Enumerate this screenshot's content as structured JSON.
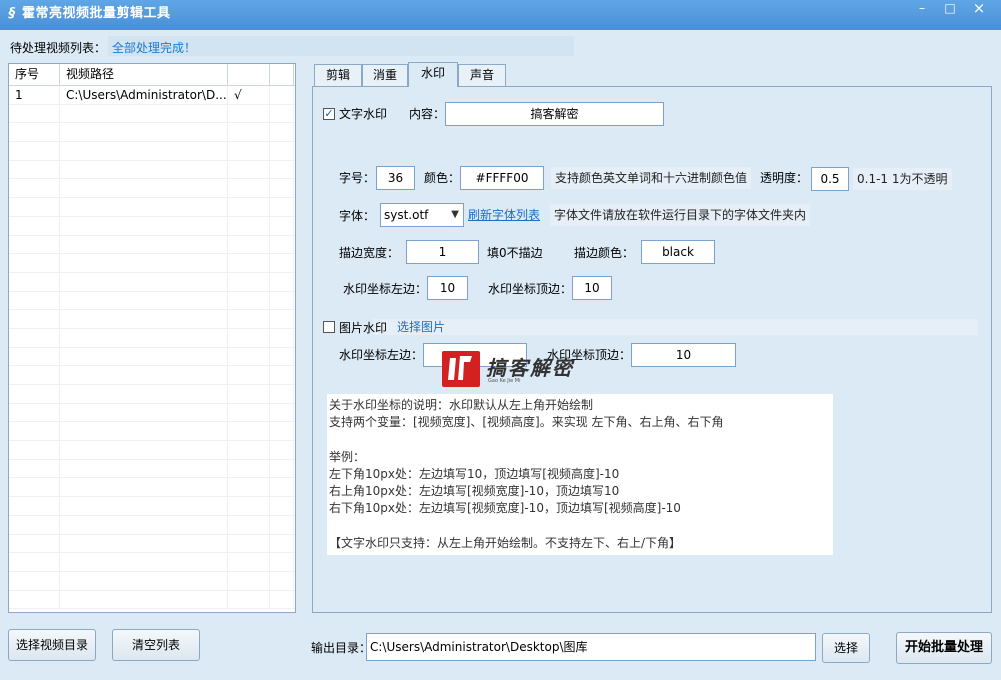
{
  "window": {
    "title": "霍常亮视频批量剪辑工具",
    "minimize_glyph": "–",
    "maximize_glyph": "□",
    "close_glyph": "×"
  },
  "pending": {
    "label": "待处理视频列表：",
    "status": "全部处理完成！"
  },
  "video_list": {
    "columns": [
      "序号",
      "视频路径",
      "",
      ""
    ],
    "rows": [
      {
        "index": "1",
        "path": "C:\\Users\\Administrator\\D...",
        "done": "√"
      }
    ]
  },
  "tabs": [
    {
      "label": "剪辑"
    },
    {
      "label": "消重"
    },
    {
      "label": "水印"
    },
    {
      "label": "声音"
    }
  ],
  "text_watermark": {
    "checkbox_label": "文字水印",
    "checked_mark": "✓",
    "content_label": "内容：",
    "content_value": "搞客解密",
    "size_label": "字号：",
    "size_value": "36",
    "color_label": "颜色：",
    "color_value": "#FFFF00",
    "color_hint": "支持颜色英文单词和十六进制颜色值",
    "opacity_label": "透明度：",
    "opacity_value": "0.5",
    "opacity_hint": "0.1-1 1为不透明",
    "font_label": "字体：",
    "font_value": "syst.otf",
    "refresh_fonts": "刷新字体列表",
    "font_hint": "字体文件请放在软件运行目录下的字体文件夹内",
    "stroke_width_label": "描边宽度：",
    "stroke_width_value": "1",
    "stroke_width_hint": "填0不描边",
    "stroke_color_label": "描边颜色：",
    "stroke_color_value": "black",
    "left_label": "水印坐标左边：",
    "left_value": "10",
    "top_label": "水印坐标顶边：",
    "top_value": "10"
  },
  "image_watermark": {
    "checkbox_label": "图片水印",
    "select_image": "选择图片",
    "left_label": "水印坐标左边：",
    "left_value": "",
    "top_label": "水印坐标顶边：",
    "top_value": "10"
  },
  "notes": [
    "关于水印坐标的说明：水印默认从左上角开始绘制",
    "支持两个变量：[视频宽度]、[视频高度]。来实现 左下角、右上角、右下角",
    "",
    "举例：",
    "左下角10px处：左边填写10，顶边填写[视频高度]-10",
    "右上角10px处：左边填写[视频宽度]-10，顶边填写10",
    "右下角10px处：左边填写[视频宽度]-10，顶边填写[视频高度]-10",
    "",
    "【文字水印只支持：从左上角开始绘制。不支持左下、右上/下角】"
  ],
  "watermark_overlay": {
    "text": "搞客解密",
    "subtext": "Gao Ke Jie Mi",
    "color": "#d42020"
  },
  "bottom": {
    "select_dir": "选择视频目录",
    "clear_list": "清空列表",
    "output_label": "输出目录：",
    "output_value": "C:\\Users\\Administrator\\Desktop\\图库",
    "choose": "选择",
    "start": "开始批量处理"
  }
}
